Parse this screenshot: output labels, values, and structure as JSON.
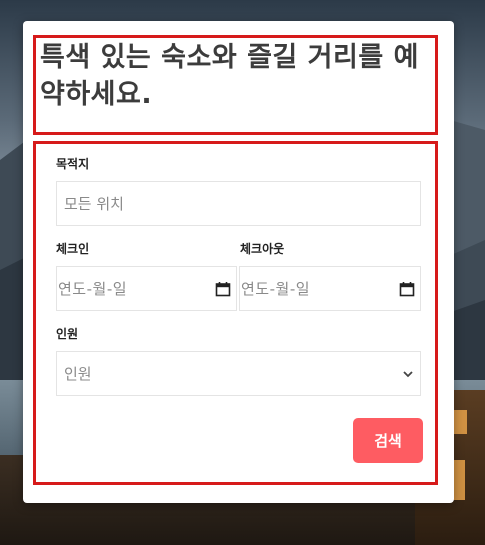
{
  "hero": {
    "headline": "특색 있는 숙소와 즐길 거리를 예약하세요."
  },
  "form": {
    "destination": {
      "label": "목적지",
      "placeholder": "모든 위치"
    },
    "checkin": {
      "label": "체크인",
      "placeholder": "연도-월-일"
    },
    "checkout": {
      "label": "체크아웃",
      "placeholder": "연도-월-일"
    },
    "guests": {
      "label": "인원",
      "selected": "인원"
    },
    "search_label": "검색"
  },
  "colors": {
    "accent": "#fe5c62",
    "highlight_outline": "#d61a1a"
  }
}
